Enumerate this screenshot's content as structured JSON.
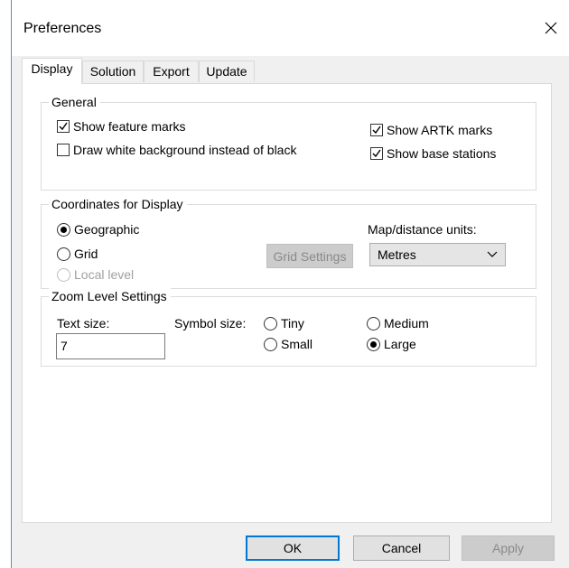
{
  "window": {
    "title": "Preferences",
    "close_icon": "close-icon"
  },
  "tabs": [
    {
      "label": "Display",
      "active": true
    },
    {
      "label": "Solution",
      "active": false
    },
    {
      "label": "Export",
      "active": false
    },
    {
      "label": "Update",
      "active": false
    }
  ],
  "general": {
    "title": "General",
    "show_feature_marks": {
      "label": "Show feature marks",
      "checked": true
    },
    "draw_white_background": {
      "label": "Draw white background instead of black",
      "checked": false
    },
    "show_artk_marks": {
      "label": "Show ARTK marks",
      "checked": true
    },
    "show_base_stations": {
      "label": "Show base stations",
      "checked": true
    }
  },
  "coordinates": {
    "title": "Coordinates for Display",
    "options": [
      {
        "label": "Geographic",
        "selected": true,
        "enabled": true
      },
      {
        "label": "Grid",
        "selected": false,
        "enabled": true
      },
      {
        "label": "Local level",
        "selected": false,
        "enabled": false
      }
    ],
    "grid_settings_label": "Grid Settings",
    "units_label": "Map/distance units:",
    "units_value": "Metres"
  },
  "zoom": {
    "title": "Zoom Level Settings",
    "text_size_label": "Text size:",
    "text_size_value": "7",
    "symbol_size_label": "Symbol size:",
    "symbol_options": [
      {
        "label": "Tiny",
        "selected": false
      },
      {
        "label": "Small",
        "selected": false
      },
      {
        "label": "Medium",
        "selected": false
      },
      {
        "label": "Large",
        "selected": true
      }
    ]
  },
  "buttons": {
    "ok": "OK",
    "cancel": "Cancel",
    "apply": "Apply"
  },
  "colors": {
    "focus_accent": "#0078d7",
    "window_border": "#5a8fd0"
  }
}
